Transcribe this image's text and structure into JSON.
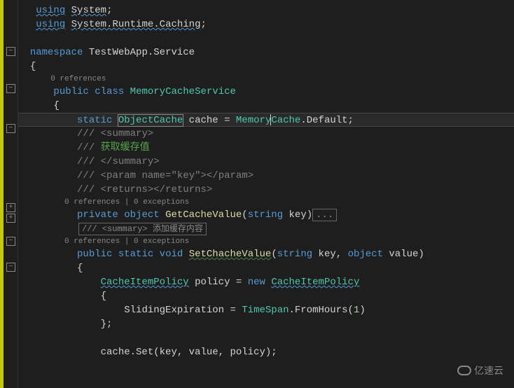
{
  "lines": {
    "using1": "using",
    "system": "System",
    "using2": "using",
    "runtimeCaching": "System.Runtime.Caching",
    "namespace": "namespace",
    "nsName": "TestWebApp.Service",
    "refs0": "0 references",
    "public": "public",
    "class": "class",
    "className": "MemoryCacheService",
    "static": "static",
    "objectCache": "ObjectCache",
    "cacheVar": "cache",
    "eq": "=",
    "memoryCache": "MemoryCache",
    "default": ".Default;",
    "summaryOpen": "/// <summary>",
    "summaryText": "/// 获取缓存值",
    "summaryClose": "/// </summary>",
    "paramLine": "/// <param name=\"key\"></param>",
    "returnsLine": "/// <returns></returns>",
    "refsExc": "0 references | 0 exceptions",
    "private": "private",
    "object": "object",
    "getCacheValue": "GetCacheValue",
    "string": "string",
    "key": "key",
    "collapsedSummary": "/// <summary> 添加缓存内容",
    "void": "void",
    "setCacheValue": "SetChacheValue",
    "value": "value",
    "cacheItemPolicy": "CacheItemPolicy",
    "policy": "policy",
    "new": "new",
    "slidingExpiration": "SlidingExpiration",
    "timeSpan": "TimeSpan",
    "fromHours": ".FromHours(",
    "one": "1",
    "cacheSet": "cache.Set(key, value, policy);"
  },
  "watermark": "亿速云"
}
